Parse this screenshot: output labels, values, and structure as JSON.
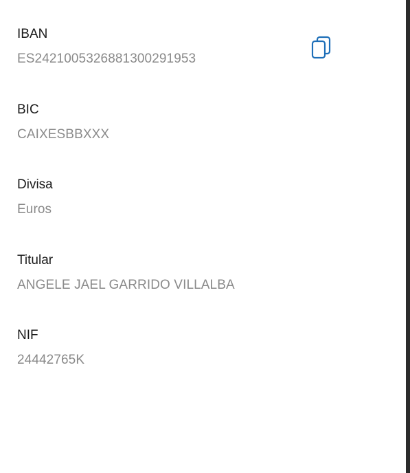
{
  "accent_color": "#1e6fb8",
  "fields": {
    "iban": {
      "label": "IBAN",
      "value": "ES2421005326881300291953"
    },
    "bic": {
      "label": "BIC",
      "value": "CAIXESBBXXX"
    },
    "divisa": {
      "label": "Divisa",
      "value": "Euros"
    },
    "titular": {
      "label": "Titular",
      "value": "ANGELE JAEL GARRIDO VILLALBA"
    },
    "nif": {
      "label": "NIF",
      "value": "24442765K"
    }
  },
  "actions": {
    "copy_icon": "copy-icon"
  }
}
